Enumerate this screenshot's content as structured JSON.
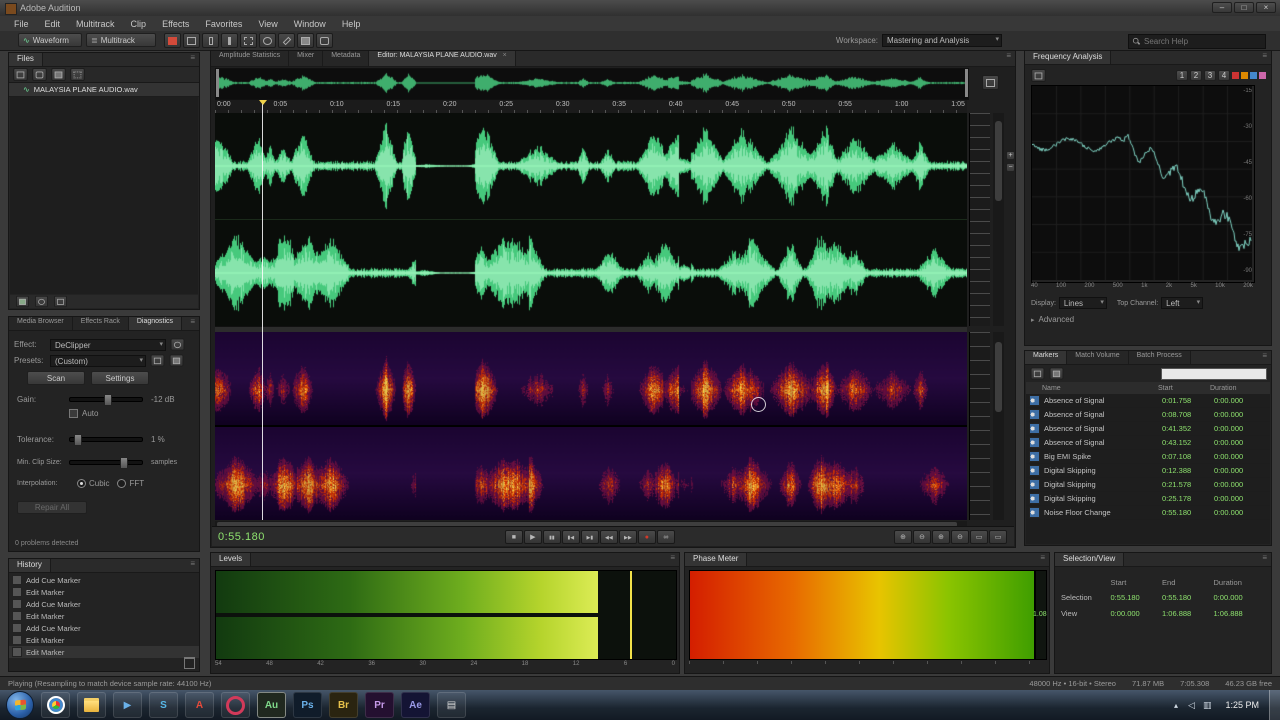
{
  "window": {
    "title": "Adobe Audition"
  },
  "menu": {
    "items": [
      "File",
      "Edit",
      "Multitrack",
      "Clip",
      "Effects",
      "Favorites",
      "View",
      "Window",
      "Help"
    ]
  },
  "toolbar": {
    "waveform": "Waveform",
    "multitrack": "Multitrack",
    "workspace_label": "Workspace:",
    "workspace_value": "Mastering and Analysis",
    "search_placeholder": "Search Help"
  },
  "files": {
    "tab": "Files",
    "file_name": "MALAYSIA PLANE AUDIO.wav"
  },
  "left_tabs": {
    "media_browser": "Media Browser",
    "effects_rack": "Effects Rack",
    "diagnostics": "Diagnostics"
  },
  "diagnostics": {
    "effect_label": "Effect:",
    "effect_value": "DeClipper",
    "presets_label": "Presets:",
    "presets_value": "(Custom)",
    "scan_button": "Scan",
    "settings_button": "Settings",
    "gain_label": "Gain:",
    "auto_label": "Auto",
    "tolerance_label": "Tolerance:",
    "tolerance_value": "1 %",
    "min_clip_label": "Min. Clip Size:",
    "samples_label": "samples",
    "interpolation_label": "Interpolation:",
    "cubic_label": "Cubic",
    "fft_label": "FFT",
    "repair_button": "Repair All",
    "status": "0 problems detected"
  },
  "history": {
    "tab": "History",
    "items": [
      "Add Cue Marker",
      "Edit Marker",
      "Add Cue Marker",
      "Edit Marker",
      "Add Cue Marker",
      "Edit Marker",
      "Edit Marker"
    ]
  },
  "editor": {
    "tabs": [
      "Amplitude Statistics",
      "Mixer",
      "Metadata"
    ],
    "active_tab": "Editor: MALAYSIA PLANE AUDIO.wav",
    "ruler_times": [
      "0:00",
      "0:05",
      "0:10",
      "0:15",
      "0:20",
      "0:25",
      "0:30",
      "0:35",
      "0:40",
      "0:45",
      "0:50",
      "0:55",
      "1:00",
      "1:05"
    ],
    "time_display": "0:55.180"
  },
  "transport": {
    "stop": "■",
    "play": "▶",
    "pause": "▮▮",
    "prev": "▮◀",
    "next": "▶▮",
    "rew": "◀◀",
    "fwd": "▶▶",
    "record": "●",
    "loop": "∞",
    "zoom_in": "⊕",
    "zoom_out": "⊖"
  },
  "frequency": {
    "tab": "Frequency Analysis",
    "holds": [
      "1",
      "2",
      "3",
      "4"
    ],
    "display_label": "Display:",
    "display_value": "Lines",
    "channel_label": "Top Channel:",
    "channel_value": "Left",
    "advanced_label": "Advanced",
    "x_labels": [
      "40",
      "100",
      "200",
      "500",
      "1k",
      "2k",
      "5k",
      "10k",
      "20k"
    ],
    "y_labels": [
      "-15",
      "-30",
      "-45",
      "-60",
      "-75",
      "-90"
    ]
  },
  "markers": {
    "tab_markers": "Markers",
    "tab_match": "Match Volume",
    "tab_batch": "Batch Process",
    "col_name": "Name",
    "col_start": "Start",
    "col_duration": "Duration",
    "rows": [
      {
        "name": "Absence of Signal",
        "start": "0:01.758",
        "duration": "0:00.000"
      },
      {
        "name": "Absence of Signal",
        "start": "0:08.708",
        "duration": "0:00.000"
      },
      {
        "name": "Absence of Signal",
        "start": "0:41.352",
        "duration": "0:00.000"
      },
      {
        "name": "Absence of Signal",
        "start": "0:43.152",
        "duration": "0:00.000"
      },
      {
        "name": "Big EMI Spike",
        "start": "0:07.108",
        "duration": "0:00.000"
      },
      {
        "name": "Digital Skipping",
        "start": "0:12.388",
        "duration": "0:00.000"
      },
      {
        "name": "Digital Skipping",
        "start": "0:21.578",
        "duration": "0:00.000"
      },
      {
        "name": "Digital Skipping",
        "start": "0:25.178",
        "duration": "0:00.000"
      },
      {
        "name": "Noise Floor Change",
        "start": "0:55.180",
        "duration": "0:00.000"
      }
    ]
  },
  "levels": {
    "tab": "Levels",
    "scale": [
      "54",
      "48",
      "42",
      "36",
      "30",
      "24",
      "18",
      "12",
      "6",
      "0"
    ]
  },
  "phase": {
    "tab": "Phase Meter",
    "value": "1.08"
  },
  "selection_view": {
    "tab": "Selection/View",
    "col_start": "Start",
    "col_end": "End",
    "col_duration": "Duration",
    "row_selection": "Selection",
    "row_view": "View",
    "selection": {
      "start": "0:55.180",
      "end": "0:55.180",
      "duration": "0:00.000"
    },
    "view": {
      "start": "0:00.000",
      "end": "1:06.888",
      "duration": "1:06.888"
    }
  },
  "status_bar": {
    "left": "Playing (Resampling to match device sample rate: 44100 Hz)",
    "format": "48000 Hz • 16-bit • Stereo",
    "size": "71.87 MB",
    "duration": "7:05.308",
    "free": "46.23 GB free"
  },
  "taskbar": {
    "clock": "1:25 PM",
    "audition": "Au",
    "photoshop": "Ps",
    "bridge": "Br",
    "premiere": "Pr",
    "aftereffects": "Ae"
  }
}
